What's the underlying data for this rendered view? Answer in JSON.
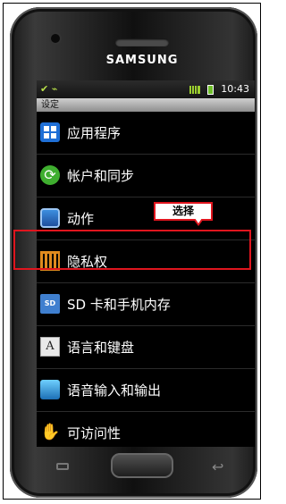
{
  "device": {
    "brand": "SAMSUNG"
  },
  "status_bar": {
    "time": "10:43",
    "left_icons": [
      "usb-icon",
      "debug-icon"
    ],
    "right_icons": [
      "signal-icon",
      "battery-icon"
    ]
  },
  "title": "设定",
  "menu": {
    "items": [
      {
        "label": "应用程序",
        "icon": "apps-icon"
      },
      {
        "label": "帐户和同步",
        "icon": "sync-icon"
      },
      {
        "label": "动作",
        "icon": "motion-icon"
      },
      {
        "label": "隐私权",
        "icon": "privacy-icon"
      },
      {
        "label": "SD 卡和手机内存",
        "icon": "sd-card-icon"
      },
      {
        "label": "语言和键盘",
        "icon": "language-icon"
      },
      {
        "label": "语音输入和输出",
        "icon": "voice-icon"
      },
      {
        "label": "可访问性",
        "icon": "accessibility-icon"
      }
    ]
  },
  "annotation": {
    "callout_label": "选择",
    "highlight_color": "#e0151e"
  },
  "icons": {
    "sd_text": "SD",
    "lang_glyph": "A",
    "sync_glyph": "⟳",
    "access_glyph": "✋"
  }
}
